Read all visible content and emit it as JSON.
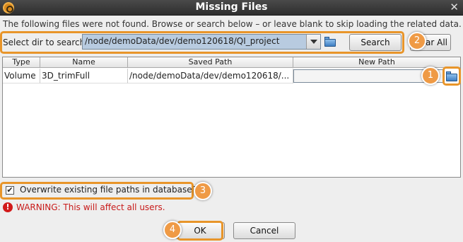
{
  "window": {
    "title": "Missing Files",
    "close_glyph": "✕",
    "app_icon": "app-logo-icon"
  },
  "info_text": "The following files were not found. Browse or search below – or leave blank to skip loading the related data.",
  "search": {
    "label": "Select dir to search",
    "dir_value": "/node/demoData/dev/demo120618/QI_project",
    "search_button": "Search",
    "clear_all_button": "Clear All",
    "clear_all_visible": "ear All"
  },
  "table": {
    "columns": [
      "Type",
      "Name",
      "Saved Path",
      "New Path"
    ],
    "rows": [
      {
        "type": "Volume",
        "name": "3D_trimFull",
        "saved_path": "/node/demoData/dev/demo120618/...",
        "new_path": ""
      }
    ]
  },
  "overwrite": {
    "label": "Overwrite existing file paths in database?",
    "checked": true,
    "check_glyph": "✔"
  },
  "warning": {
    "icon_glyph": "!",
    "text": "WARNING: This will affect all users."
  },
  "buttons": {
    "ok": "OK",
    "cancel": "Cancel"
  },
  "callouts": [
    "1",
    "2",
    "3",
    "4"
  ],
  "colors": {
    "callout_orange": "#e8952a",
    "selection_blue": "#b8cbe0",
    "warning_red": "#c81a1a",
    "titlebar": "#2e2e2e"
  }
}
